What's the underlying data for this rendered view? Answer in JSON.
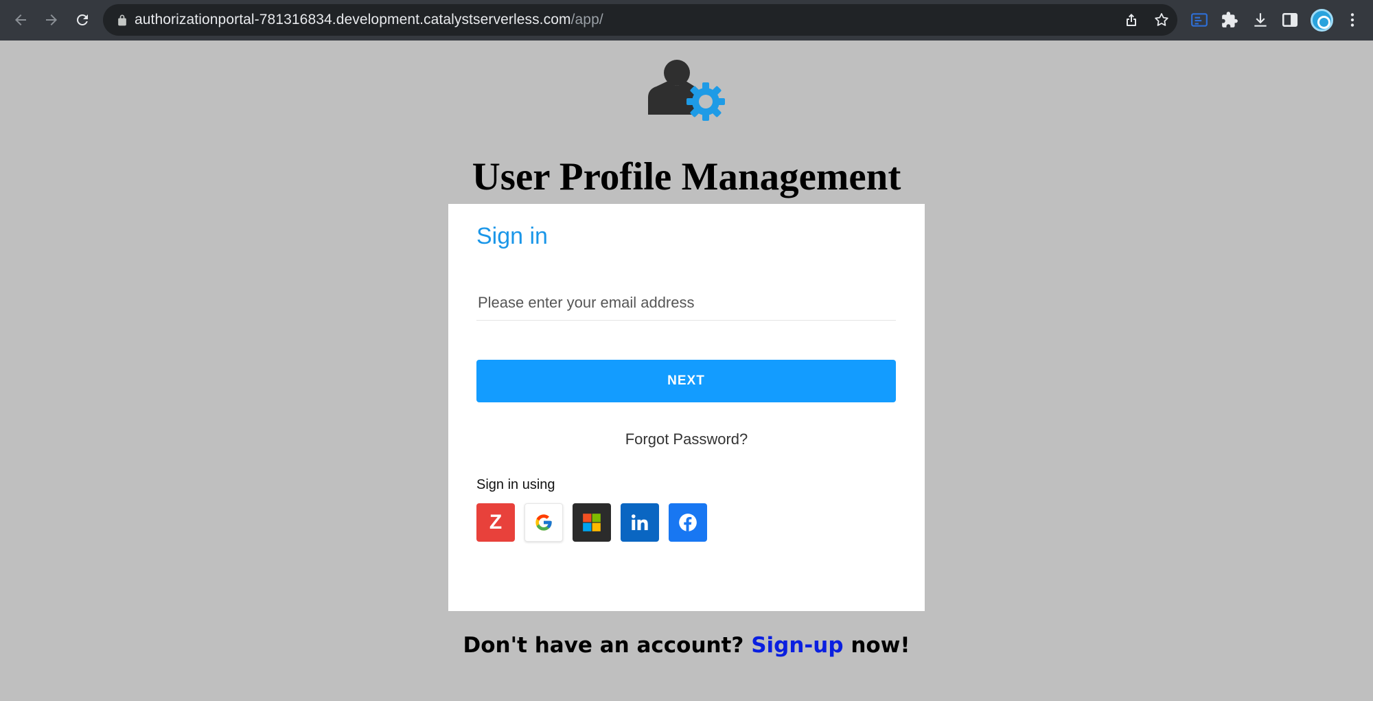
{
  "browser": {
    "url_host": "authorizationportal-781316834.development.catalystserverless.com",
    "url_path": "/app/"
  },
  "page": {
    "title": "User Profile Management"
  },
  "signin": {
    "heading": "Sign in",
    "email_placeholder": "Please enter your email address",
    "email_value": "",
    "next_label": "NEXT",
    "forgot_label": "Forgot Password?",
    "sso_label": "Sign in using",
    "zoho_letter": "Z",
    "providers": [
      "zoho",
      "google",
      "microsoft",
      "linkedin",
      "facebook"
    ]
  },
  "signup": {
    "prefix": "Don't have an account? ",
    "link": "Sign-up",
    "suffix": " now!"
  },
  "colors": {
    "page_bg": "#bfbfbf",
    "accent": "#139cff",
    "heading_blue": "#1a96e8",
    "link_blue": "#0a1fe0"
  }
}
